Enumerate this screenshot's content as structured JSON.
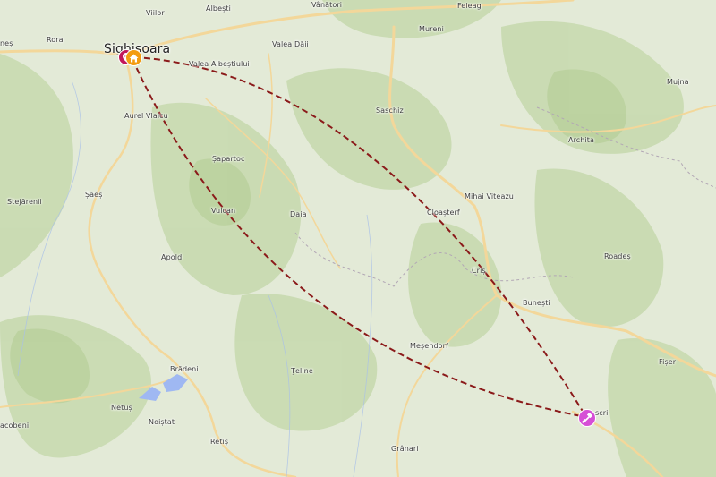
{
  "map": {
    "places": {
      "sighisoara": "Sighișoara",
      "viilor": "Viilor",
      "albesti": "Albești",
      "vanatori": "Vânători",
      "feleag": "Feleag",
      "mureni": "Mureni",
      "rora": "Rora",
      "nes": "neș",
      "valea_dai": "Valea Dăii",
      "valea_albestiului": "Valea Albeștiului",
      "mujna": "Mujna",
      "aurel_vlaicu": "Aurel Vlaicu",
      "saschiz": "Saschiz",
      "archita": "Archita",
      "spartoc": "Șapartoc",
      "stejarenii": "Stejărenii",
      "saes": "Șaeș",
      "mihai_viteazu": "Mihai Viteazu",
      "vulcan": "Vulcan",
      "daia": "Daia",
      "cloasterf": "Cloașterf",
      "apold": "Apold",
      "roades": "Roadeș",
      "cris": "Criș",
      "bunesti": "Bunești",
      "mesendorf": "Meșendorf",
      "bradeni": "Brădeni",
      "teline": "Țeline",
      "fiser": "Fișer",
      "netus": "Netuș",
      "noistat": "Noiștat",
      "viscri": "scri",
      "iacobeni": "acobeni",
      "retis": "Retiș",
      "granari": "Grânari"
    },
    "markers": {
      "home_icon": "home-icon",
      "start_icon": "location-pin-icon",
      "destination_icon": "fortress-icon"
    },
    "colors": {
      "route": "#8b1a1a",
      "home_marker": "#f39c12",
      "start_marker": "#c2185b",
      "destination_marker": "#d64fd6",
      "land": "#e3ead7",
      "forest": "#c6d9ae",
      "road": "#f6dc9e",
      "water": "#9fb8f2"
    }
  }
}
